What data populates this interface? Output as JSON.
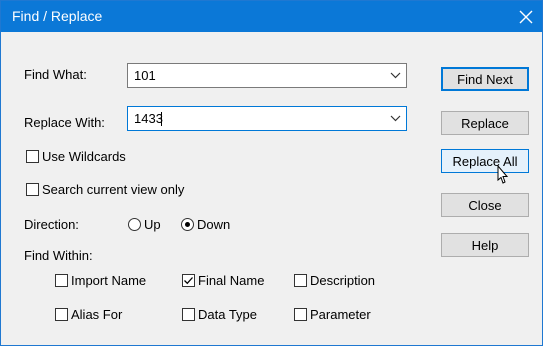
{
  "window": {
    "title": "Find / Replace"
  },
  "find": {
    "label": "Find What:",
    "value": "101"
  },
  "replace": {
    "label": "Replace With:",
    "value": "1433"
  },
  "options": {
    "use_wildcards": {
      "label": "Use Wildcards",
      "checked": false
    },
    "search_current_view": {
      "label": "Search current view only",
      "checked": false
    }
  },
  "direction": {
    "label": "Direction:",
    "up": "Up",
    "down": "Down",
    "selected": "Down"
  },
  "find_within": {
    "label": "Find Within:",
    "import_name": {
      "label": "Import Name",
      "checked": false
    },
    "final_name": {
      "label": "Final Name",
      "checked": true
    },
    "description": {
      "label": "Description",
      "checked": false
    },
    "alias_for": {
      "label": "Alias For",
      "checked": false
    },
    "data_type": {
      "label": "Data Type",
      "checked": false
    },
    "parameter": {
      "label": "Parameter",
      "checked": false
    }
  },
  "buttons": {
    "find_next": "Find Next",
    "replace": "Replace",
    "replace_all": "Replace All",
    "close": "Close",
    "help": "Help"
  },
  "icons": {
    "close": "close-icon",
    "dropdown": "chevron-down-icon",
    "check": "checkmark-icon",
    "cursor": "mouse-pointer-icon"
  },
  "colors": {
    "titlebar": "#0b78d7",
    "accent": "#0078d7",
    "dialog_bg": "#f0f0f0"
  }
}
